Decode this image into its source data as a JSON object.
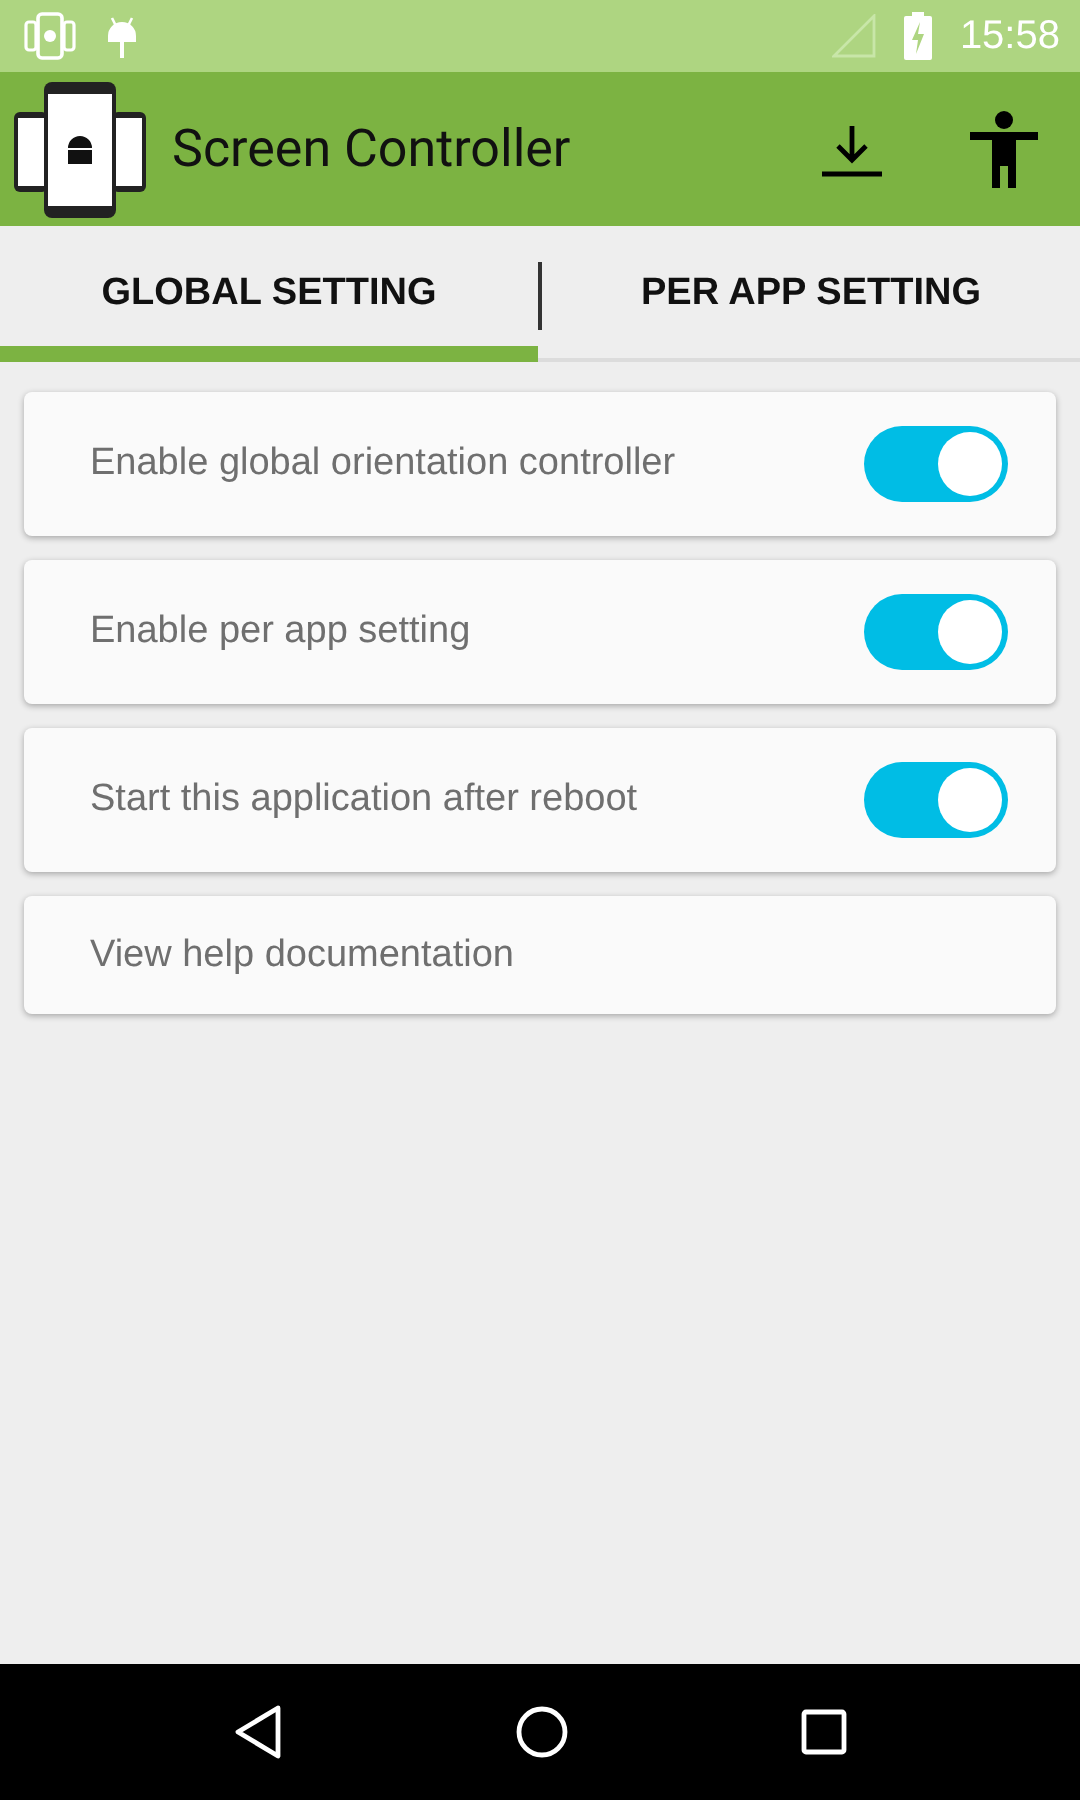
{
  "status_bar": {
    "time": "15:58"
  },
  "app_bar": {
    "title": "Screen Controller"
  },
  "tabs": [
    {
      "label": "GLOBAL SETTING",
      "selected": true
    },
    {
      "label": "PER APP SETTING",
      "selected": false
    }
  ],
  "settings": [
    {
      "kind": "switch",
      "label": "Enable global orientation controller",
      "checked": true
    },
    {
      "kind": "switch",
      "label": "Enable per app setting",
      "checked": true
    },
    {
      "kind": "switch",
      "label": "Start this application after reboot",
      "checked": true
    },
    {
      "kind": "link",
      "label": "View help documentation"
    }
  ]
}
